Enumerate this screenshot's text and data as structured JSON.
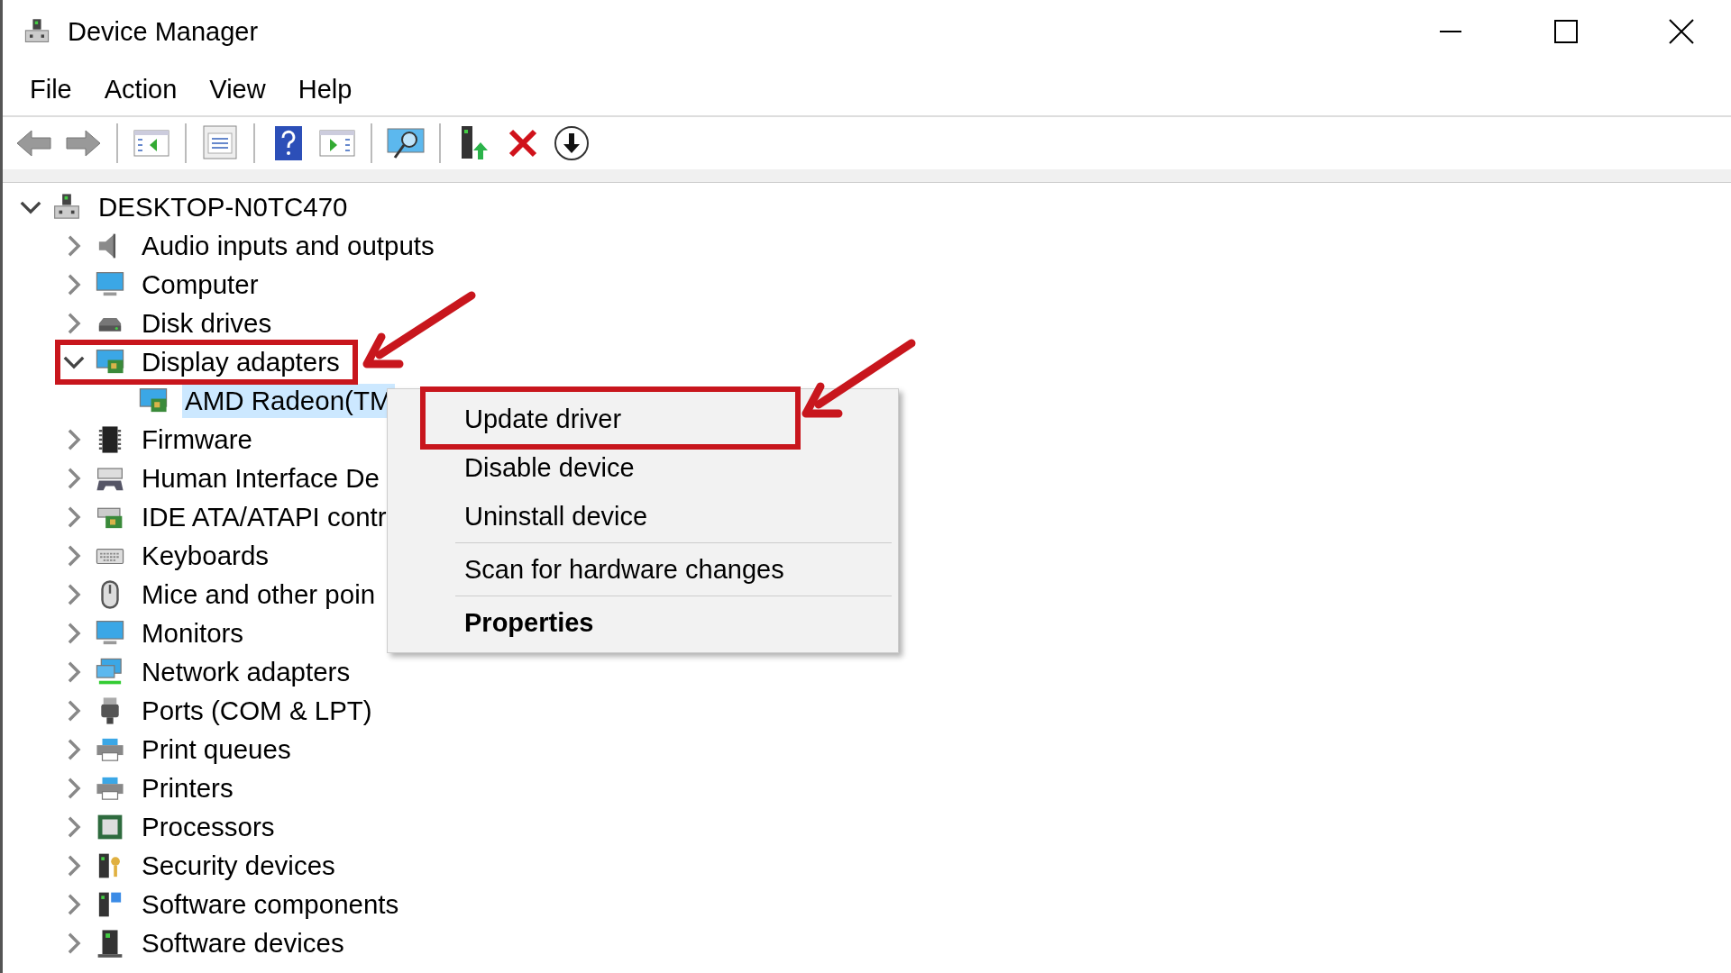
{
  "window": {
    "title": "Device Manager"
  },
  "menu_bar": [
    "File",
    "Action",
    "View",
    "Help"
  ],
  "tree": {
    "label": "DESKTOP-N0TC470",
    "expanded": true,
    "selected": false,
    "children": [
      {
        "label": "Audio inputs and outputs",
        "expanded": false,
        "selected": false
      },
      {
        "label": "Computer",
        "expanded": false,
        "selected": false
      },
      {
        "label": "Disk drives",
        "expanded": false,
        "selected": false
      },
      {
        "label": "Display adapters",
        "expanded": true,
        "selected": false,
        "children": [
          {
            "label": "AMD Radeon(TM",
            "selected": true
          }
        ]
      },
      {
        "label": "Firmware",
        "expanded": false,
        "selected": false
      },
      {
        "label": "Human Interface De",
        "expanded": false,
        "selected": false
      },
      {
        "label": "IDE ATA/ATAPI contr",
        "expanded": false,
        "selected": false
      },
      {
        "label": "Keyboards",
        "expanded": false,
        "selected": false
      },
      {
        "label": "Mice and other poin",
        "expanded": false,
        "selected": false
      },
      {
        "label": "Monitors",
        "expanded": false,
        "selected": false
      },
      {
        "label": "Network adapters",
        "expanded": false,
        "selected": false
      },
      {
        "label": "Ports (COM & LPT)",
        "expanded": false,
        "selected": false
      },
      {
        "label": "Print queues",
        "expanded": false,
        "selected": false
      },
      {
        "label": "Printers",
        "expanded": false,
        "selected": false
      },
      {
        "label": "Processors",
        "expanded": false,
        "selected": false
      },
      {
        "label": "Security devices",
        "expanded": false,
        "selected": false
      },
      {
        "label": "Software components",
        "expanded": false,
        "selected": false
      },
      {
        "label": "Software devices",
        "expanded": false,
        "selected": false
      }
    ]
  },
  "context_menu": {
    "groups": [
      [
        {
          "label": "Update driver",
          "default": false
        },
        {
          "label": "Disable device",
          "default": false
        },
        {
          "label": "Uninstall device",
          "default": false
        }
      ],
      [
        {
          "label": "Scan for hardware changes",
          "default": false
        }
      ],
      [
        {
          "label": "Properties",
          "default": true
        }
      ]
    ]
  }
}
